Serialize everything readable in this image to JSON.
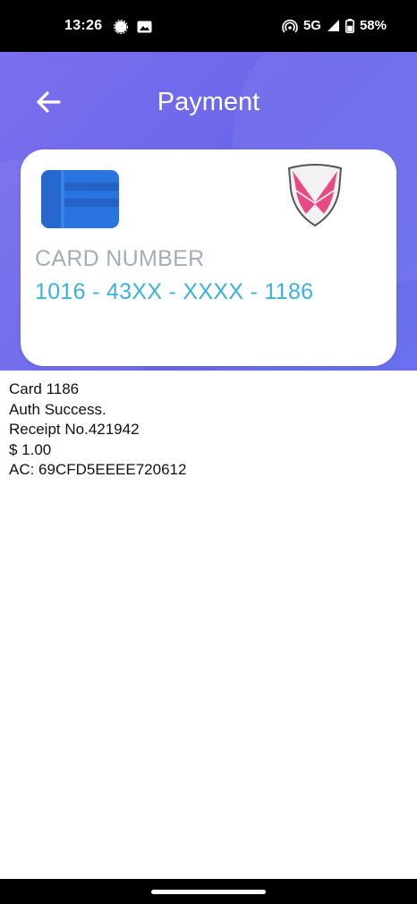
{
  "status_bar": {
    "time": "13:26",
    "notification_icons": [
      "signal-messenger-icon",
      "gallery-icon"
    ],
    "network": "5G",
    "battery": "58%",
    "battery_level": 58
  },
  "header": {
    "title": "Payment",
    "background_color": "#6c67ea"
  },
  "card": {
    "number_label": "CARD NUMBER",
    "number_value": "1016 - 43XX - XXXX - 1186",
    "chip_icon": "card-chip-icon",
    "brand_icon": "shield-logo-icon",
    "label_color": "#a6acb6",
    "number_color": "#3ab3d8"
  },
  "receipt": {
    "lines": [
      "Card 1186",
      "Auth Success.",
      "Receipt No.421942",
      "$ 1.00",
      "AC: 69CFD5EEEE720612"
    ]
  }
}
